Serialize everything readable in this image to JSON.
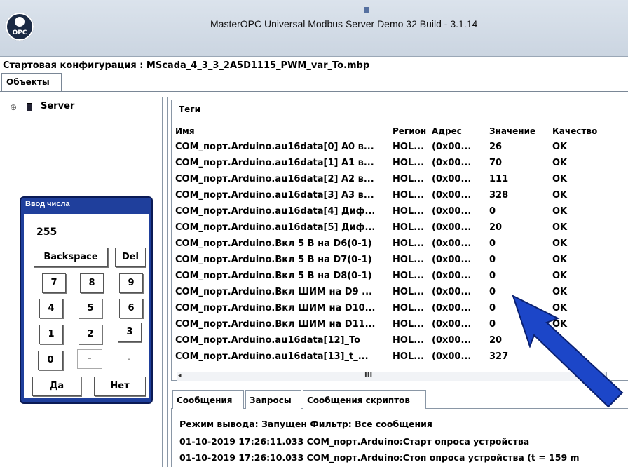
{
  "window": {
    "title": "MasterOPC Universal Modbus Server Demo 32 Build - 3.1.14",
    "logo_text": "OPC",
    "config_line": "Стартовая конфигурация : MScada_4_3_3_2A5D1115_PWM_var_To.mbp"
  },
  "tabs": {
    "objects": "Объекты"
  },
  "tree": {
    "expand_glyph": "⊕",
    "server_label": "Server"
  },
  "tags": {
    "tab_label": "Теги",
    "columns": [
      "Имя",
      "Регион",
      "Адрес",
      "Значение",
      "Качество"
    ],
    "rows": [
      {
        "name": "COM_порт.Arduino.au16data[0] A0 в...",
        "region": "HOL...",
        "address": "(0x00...",
        "value": "26",
        "quality": "OK"
      },
      {
        "name": "COM_порт.Arduino.au16data[1] A1 в...",
        "region": "HOL...",
        "address": "(0x00...",
        "value": "70",
        "quality": "OK"
      },
      {
        "name": "COM_порт.Arduino.au16data[2] A2 в...",
        "region": "HOL...",
        "address": "(0x00...",
        "value": "111",
        "quality": "OK"
      },
      {
        "name": "COM_порт.Arduino.au16data[3] A3 в...",
        "region": "HOL...",
        "address": "(0x00...",
        "value": "328",
        "quality": "OK"
      },
      {
        "name": "COM_порт.Arduino.au16data[4] Диф...",
        "region": "HOL...",
        "address": "(0x00...",
        "value": "0",
        "quality": "OK"
      },
      {
        "name": "COM_порт.Arduino.au16data[5] Диф...",
        "region": "HOL...",
        "address": "(0x00...",
        "value": "20",
        "quality": "OK"
      },
      {
        "name": "COM_порт.Arduino.Вкл 5 В на D6(0-1)",
        "region": "HOL...",
        "address": "(0x00...",
        "value": "0",
        "quality": "OK"
      },
      {
        "name": "COM_порт.Arduino.Вкл 5 В на D7(0-1)",
        "region": "HOL...",
        "address": "(0x00...",
        "value": "0",
        "quality": "OK"
      },
      {
        "name": "COM_порт.Arduino.Вкл 5 В на D8(0-1)",
        "region": "HOL...",
        "address": "(0x00...",
        "value": "0",
        "quality": "OK"
      },
      {
        "name": "COM_порт.Arduino.Вкл ШИМ на D9 ...",
        "region": "HOL...",
        "address": "(0x00...",
        "value": "0",
        "quality": "OK"
      },
      {
        "name": "COM_порт.Arduino.Вкл ШИМ на D10...",
        "region": "HOL...",
        "address": "(0x00...",
        "value": "0",
        "quality": "OK"
      },
      {
        "name": "COM_порт.Arduino.Вкл ШИМ на D11...",
        "region": "HOL...",
        "address": "(0x00...",
        "value": "0",
        "quality": "OK"
      },
      {
        "name": "COM_порт.Arduino.au16data[12]_To",
        "region": "HOL...",
        "address": "(0x00...",
        "value": "20",
        "quality": ""
      },
      {
        "name": "COM_порт.Arduino.au16data[13]_t_...",
        "region": "HOL...",
        "address": "(0x00...",
        "value": "327",
        "quality": ""
      }
    ],
    "scroll_left_glyph": "◂",
    "scroll_thumb_glyph": "III"
  },
  "bottom_tabs": {
    "messages": "Сообщения",
    "requests": "Запросы",
    "script_messages": "Сообщения скриптов"
  },
  "log": [
    "Режим вывода: Запущен Фильтр: Все сообщения",
    "01-10-2019 17:26:11.033 COM_порт.Arduino:Старт опроса устройства",
    "01-10-2019 17:26:10.033 COM_порт.Arduino:Стоп опроса устройства (t = 159 m"
  ],
  "dialog": {
    "title": "Ввод числа",
    "value": "255",
    "keys": {
      "backspace": "Backspace",
      "del": "Del",
      "k7": "7",
      "k8": "8",
      "k9": "9",
      "k4": "4",
      "k5": "5",
      "k6": "6",
      "k1": "1",
      "k2": "2",
      "k3": "3",
      "k0": "0",
      "minus": "-",
      "dot": ".",
      "ok": "Да",
      "cancel": "Нет"
    }
  },
  "colors": {
    "dialog_frame": "#1f3f9c",
    "arrow": "#1c46c8"
  }
}
